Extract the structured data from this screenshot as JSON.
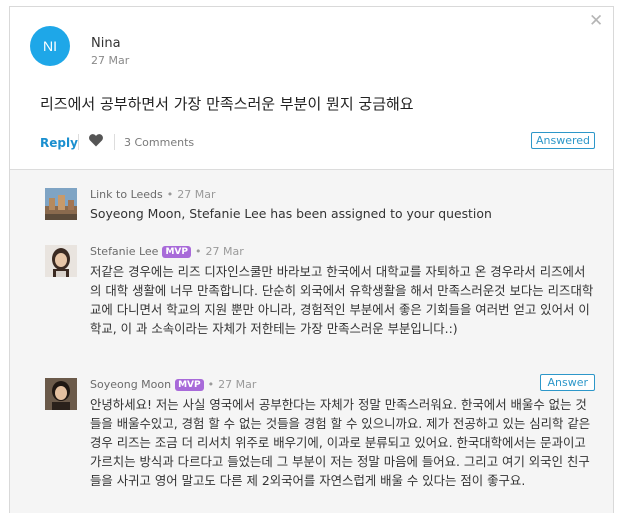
{
  "question": {
    "avatar_initials": "NI",
    "author": "Nina",
    "date": "27 Mar",
    "text": "리즈에서 공부하면서 가장 만족스러운 부분이 뭔지 궁금해요",
    "reply_label": "Reply",
    "comments_label": "3 Comments",
    "status_badge": "Answered"
  },
  "comments": [
    {
      "author": "Link to Leeds",
      "mvp": "",
      "date": "27 Mar",
      "text": "Soyeong Moon, Stefanie Lee has been assigned to your question"
    },
    {
      "author": "Stefanie Lee",
      "mvp": "MVP",
      "date": "27 Mar",
      "text": "저같은 경우에는 리즈 디자인스쿨만 바라보고 한국에서 대학교를 자퇴하고 온 경우라서 리즈에서의 대학 생활에 너무 만족합니다. 단순히 외국에서 유학생활을 해서 만족스러운것 보다는 리즈대학교에 다니면서 학교의 지원 뿐만 아니라, 경험적인 부분에서 좋은 기회들을 여러번 얻고 있어서 이 학교, 이 과 소속이라는 자체가 저한테는 가장 만족스러운 부분입니다.:)"
    },
    {
      "author": "Soyeong Moon",
      "mvp": "MVP",
      "date": "27 Mar",
      "answer_label": "Answer",
      "text": "안녕하세요! 저는 사실 영국에서 공부한다는 자체가 정말 만족스러워요. 한국에서 배울수 없는 것들을 배울수있고, 경험 할 수 없는 것들을 경험 할 수 있으니까요. 제가 전공하고 있는 심리학 같은 경우 리즈는 조금 더 리서치 위주로 배우기에, 이과로 분류되고 있어요. 한국대학에서는 문과이고 가르치는 방식과 다르다고 들었는데 그 부분이 저는 정말 마음에 들어요. 그리고 여기 외국인 친구들을 사귀고 영어 말고도 다른 제 2외국어를 자연스럽게 배울 수 있다는 점이 좋구요."
    }
  ],
  "colors": {
    "accent": "#1a8fcf",
    "avatar_bg": "#1ea7e8",
    "mvp_badge": "#a86ad9",
    "thread_bg": "#f5f5f5"
  },
  "icons": {
    "close": "close-icon",
    "like": "heart-icon"
  }
}
